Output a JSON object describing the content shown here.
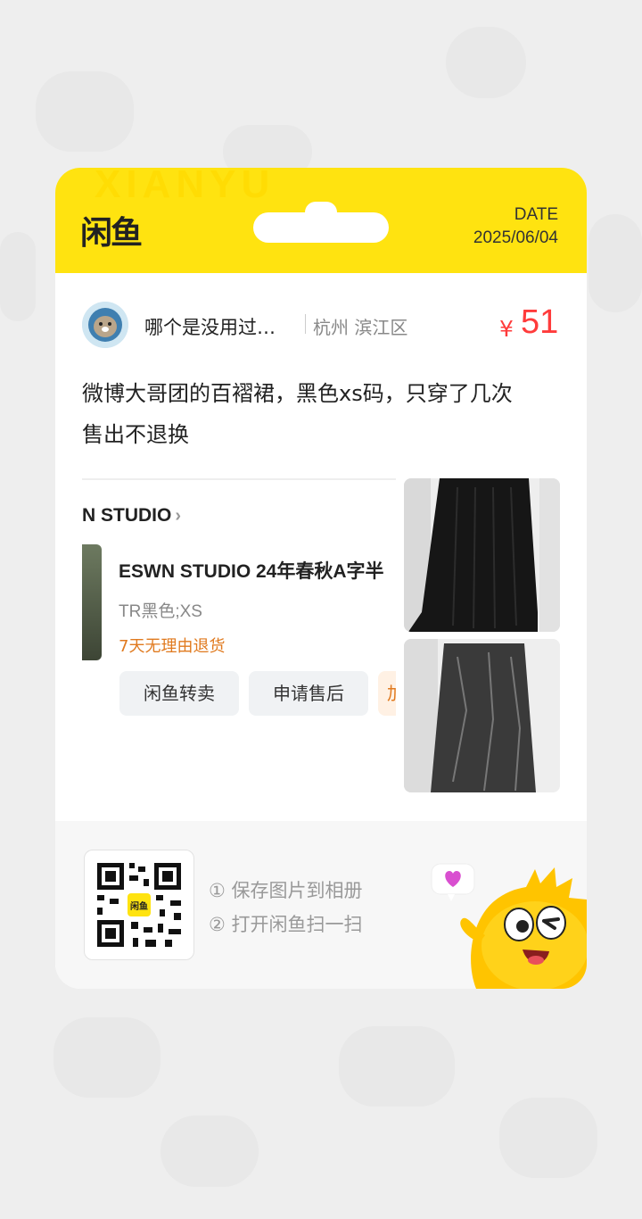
{
  "app": {
    "logo": "闲鱼",
    "watermark": "XIANYU"
  },
  "header": {
    "date_label": "DATE",
    "date_value": "2025/06/04"
  },
  "seller": {
    "username": "哪个是没用过…",
    "location": "杭州 滨江区"
  },
  "price": {
    "symbol": "¥",
    "value": "51"
  },
  "description": {
    "line1": "微博大哥团的百褶裙，黑色xs码，只穿了几次",
    "line2": "售出不退换"
  },
  "order_screenshot": {
    "shop_name": "N STUDIO",
    "product_title": "ESWN STUDIO 24年春秋A字半",
    "spec": "TR黑色;XS",
    "return_policy": "7天无理由退货",
    "buttons": [
      "闲鱼转卖",
      "申请售后",
      "加"
    ]
  },
  "footer": {
    "qr_center_label": "闲鱼",
    "step1": "① 保存图片到相册",
    "step2": "② 打开闲鱼扫一扫"
  },
  "colors": {
    "brand_yellow": "#ffe310",
    "price_red": "#ff3b3b",
    "return_orange": "#e07a1f"
  },
  "icons": [
    "chevron-right-icon",
    "qr-code-icon",
    "mascot-fish-icon",
    "heart-bubble-icon"
  ]
}
